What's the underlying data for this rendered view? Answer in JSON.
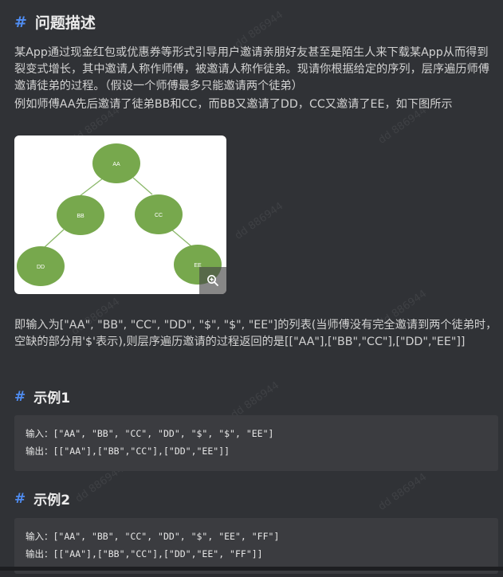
{
  "title": "问题描述",
  "hash_symbol": "#",
  "description": {
    "line1": "某App通过现金红包或优惠券等形式引导用户邀请亲朋好友甚至是陌生人来下载某App从而得到裂变式增长，其中邀请人称作师傅，被邀请人称作徒弟。现请你根据给定的序列，层序遍历师傅邀请徒弟的过程。（假设一个师傅最多只能邀请两个徒弟）",
    "line2": "例如师傅AA先后邀请了徒弟BB和CC，而BB又邀请了DD，CC又邀请了EE，如下图所示"
  },
  "tree": {
    "nodes": [
      "AA",
      "BB",
      "CC",
      "DD",
      "EE"
    ],
    "node_color": "#77a84d",
    "edge_color": "#8bb86a"
  },
  "explanation": "即输入为[\"AA\", \"BB\", \"CC\", \"DD\", \"$\", \"$\", \"EE\"]的列表(当师傅没有完全邀请到两个徒弟时，空缺的部分用'$'表示),则层序遍历邀请的过程返回的是[[\"AA\"],[\"BB\",\"CC\"],[\"DD\",\"EE\"]]",
  "example1": {
    "title": "示例1",
    "input": "输入：[\"AA\", \"BB\", \"CC\", \"DD\", \"$\", \"$\", \"EE\"]",
    "output": "输出：[[\"AA\"],[\"BB\",\"CC\"],[\"DD\",\"EE\"]]"
  },
  "example2": {
    "title": "示例2",
    "input": "输入：[\"AA\", \"BB\", \"CC\", \"DD\", \"$\", \"EE\", \"FF\"]",
    "output": "输出：[[\"AA\"],[\"BB\",\"CC\"],[\"DD\",\"EE\", \"FF\"]]"
  },
  "watermark": "dd 886944",
  "colors": {
    "accent": "#4f8cf0",
    "background": "#303236",
    "code_background": "#3b3c40"
  },
  "icons": {
    "zoom": "zoom-in-icon"
  }
}
